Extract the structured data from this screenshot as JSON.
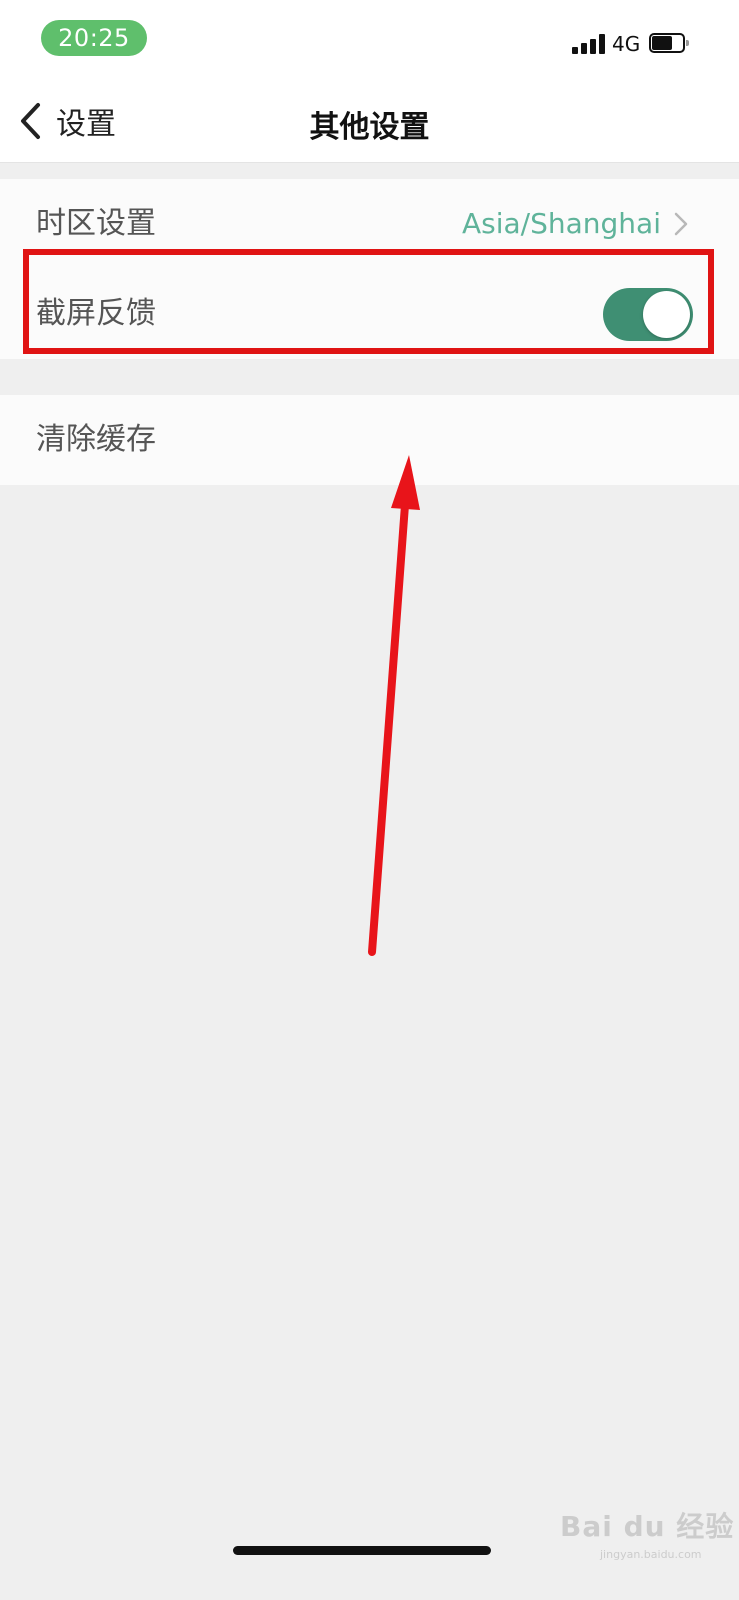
{
  "status_bar": {
    "time": "20:25",
    "network": "4G",
    "time_pill_color": "#5fbf6c"
  },
  "nav": {
    "back_label": "设置",
    "title": "其他设置"
  },
  "settings": {
    "timezone": {
      "label": "时区设置",
      "value": "Asia/Shanghai"
    },
    "screenshot_feedback": {
      "label": "截屏反馈",
      "enabled": true
    },
    "clear_cache": {
      "label": "清除缓存"
    }
  },
  "colors": {
    "toggle_on": "#3f8f73",
    "accent_value": "#5fb39a",
    "annotation": "#e01414"
  },
  "icons": [
    "signal-icon",
    "battery-icon",
    "back-chevron-icon",
    "chevron-right-icon",
    "annotation-arrow-icon"
  ],
  "watermark": {
    "brand": "Bai du 经验",
    "sub": "jingyan.baidu.com"
  }
}
